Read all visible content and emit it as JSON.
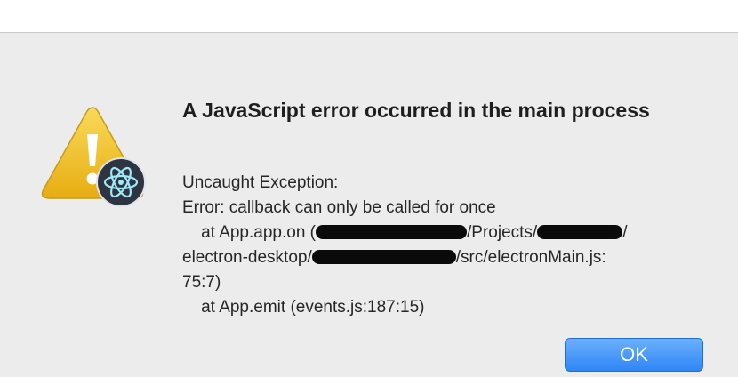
{
  "dialog": {
    "title": "A JavaScript error occurred in the main process",
    "message_lines": [
      "Uncaught Exception:",
      "Error: callback can only be called for once",
      "    at App.app.on (",
      "/Projects/",
      "/",
      "electron-desktop/",
      "/src/electronMain.js:",
      "75:7)",
      "    at App.emit (events.js:187:15)"
    ],
    "ok_label": "OK"
  },
  "icons": {
    "app_icon": "warning-triangle-with-electron-badge-icon"
  },
  "colors": {
    "dialog_background": "#ececec",
    "button_blue": "#2f86f7",
    "warning_yellow": "#f2c12e"
  }
}
